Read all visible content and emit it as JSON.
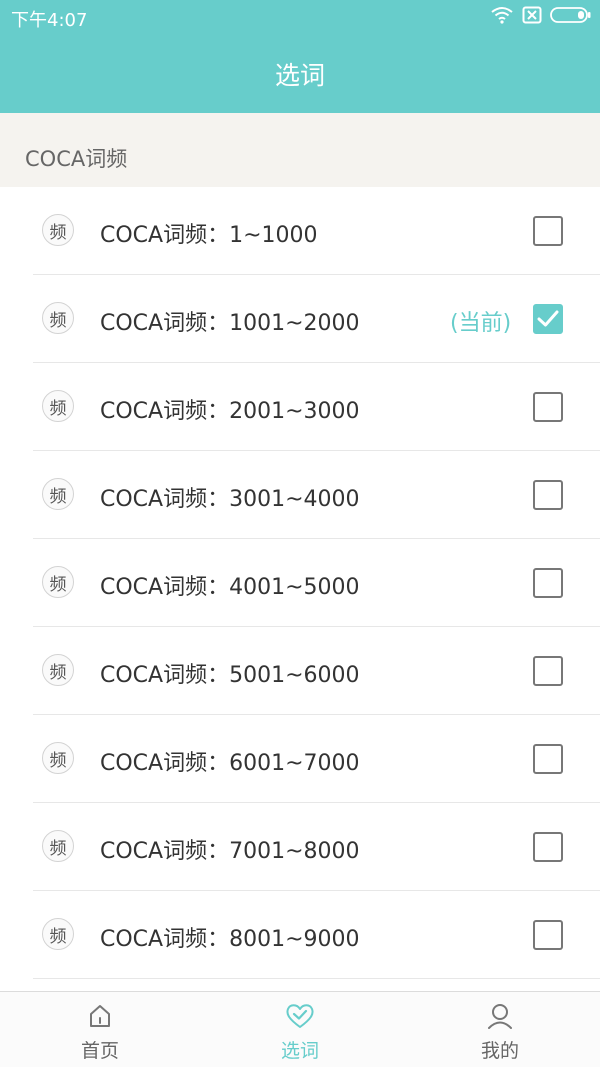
{
  "status_bar": {
    "time": "下午4:07",
    "icons": [
      "wifi-icon",
      "sim-disabled-icon",
      "battery-icon"
    ]
  },
  "header": {
    "title": "选词"
  },
  "section": {
    "title": "COCA词频"
  },
  "list": {
    "items": [
      {
        "icon_text": "频",
        "label": "COCA词频：1~1000",
        "tag": "",
        "checked": false
      },
      {
        "icon_text": "频",
        "label": "COCA词频：1001~2000",
        "tag": "(当前)",
        "checked": true
      },
      {
        "icon_text": "频",
        "label": "COCA词频：2001~3000",
        "tag": "",
        "checked": false
      },
      {
        "icon_text": "频",
        "label": "COCA词频：3001~4000",
        "tag": "",
        "checked": false
      },
      {
        "icon_text": "频",
        "label": "COCA词频：4001~5000",
        "tag": "",
        "checked": false
      },
      {
        "icon_text": "频",
        "label": "COCA词频：5001~6000",
        "tag": "",
        "checked": false
      },
      {
        "icon_text": "频",
        "label": "COCA词频：6001~7000",
        "tag": "",
        "checked": false
      },
      {
        "icon_text": "频",
        "label": "COCA词频：7001~8000",
        "tag": "",
        "checked": false
      },
      {
        "icon_text": "频",
        "label": "COCA词频：8001~9000",
        "tag": "",
        "checked": false
      }
    ]
  },
  "bottom_nav": {
    "items": [
      {
        "label": "首页",
        "icon": "home-icon",
        "active": false
      },
      {
        "label": "选词",
        "icon": "heart-check-icon",
        "active": true
      },
      {
        "label": "我的",
        "icon": "profile-icon",
        "active": false
      }
    ]
  },
  "colors": {
    "accent": "#67cdcb",
    "section_bg": "#f5f3ef",
    "text_primary": "#333333",
    "text_secondary": "#666666"
  }
}
